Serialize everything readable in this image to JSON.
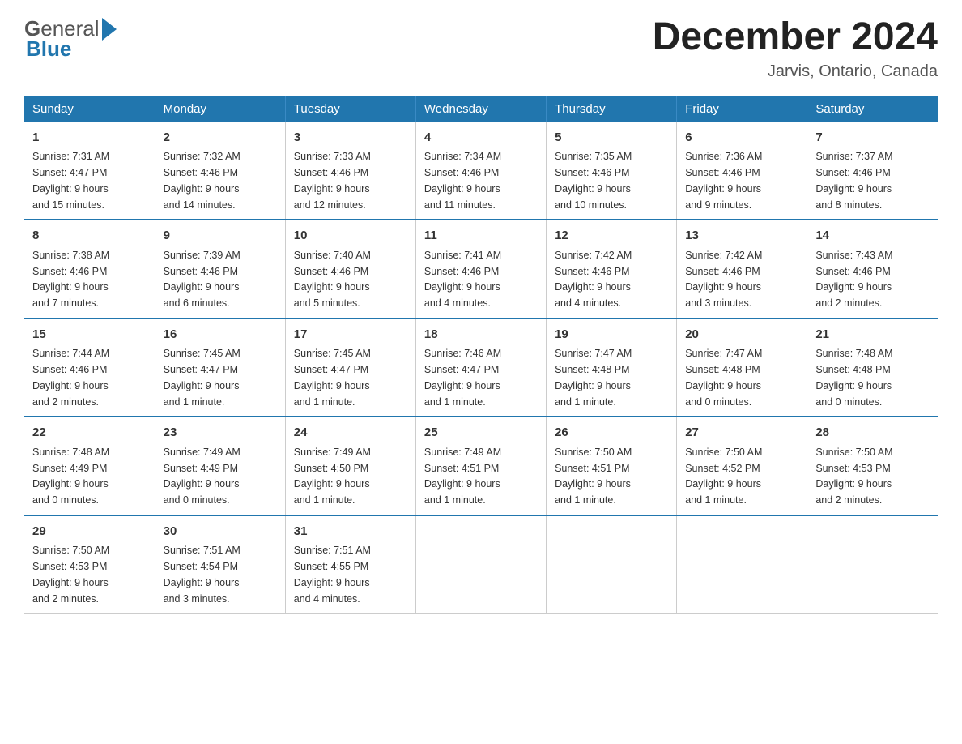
{
  "header": {
    "month_title": "December 2024",
    "location": "Jarvis, Ontario, Canada",
    "logo_general": "General",
    "logo_blue": "Blue"
  },
  "days_of_week": [
    "Sunday",
    "Monday",
    "Tuesday",
    "Wednesday",
    "Thursday",
    "Friday",
    "Saturday"
  ],
  "weeks": [
    [
      {
        "num": "1",
        "sunrise": "7:31 AM",
        "sunset": "4:47 PM",
        "daylight": "9 hours and 15 minutes."
      },
      {
        "num": "2",
        "sunrise": "7:32 AM",
        "sunset": "4:46 PM",
        "daylight": "9 hours and 14 minutes."
      },
      {
        "num": "3",
        "sunrise": "7:33 AM",
        "sunset": "4:46 PM",
        "daylight": "9 hours and 12 minutes."
      },
      {
        "num": "4",
        "sunrise": "7:34 AM",
        "sunset": "4:46 PM",
        "daylight": "9 hours and 11 minutes."
      },
      {
        "num": "5",
        "sunrise": "7:35 AM",
        "sunset": "4:46 PM",
        "daylight": "9 hours and 10 minutes."
      },
      {
        "num": "6",
        "sunrise": "7:36 AM",
        "sunset": "4:46 PM",
        "daylight": "9 hours and 9 minutes."
      },
      {
        "num": "7",
        "sunrise": "7:37 AM",
        "sunset": "4:46 PM",
        "daylight": "9 hours and 8 minutes."
      }
    ],
    [
      {
        "num": "8",
        "sunrise": "7:38 AM",
        "sunset": "4:46 PM",
        "daylight": "9 hours and 7 minutes."
      },
      {
        "num": "9",
        "sunrise": "7:39 AM",
        "sunset": "4:46 PM",
        "daylight": "9 hours and 6 minutes."
      },
      {
        "num": "10",
        "sunrise": "7:40 AM",
        "sunset": "4:46 PM",
        "daylight": "9 hours and 5 minutes."
      },
      {
        "num": "11",
        "sunrise": "7:41 AM",
        "sunset": "4:46 PM",
        "daylight": "9 hours and 4 minutes."
      },
      {
        "num": "12",
        "sunrise": "7:42 AM",
        "sunset": "4:46 PM",
        "daylight": "9 hours and 4 minutes."
      },
      {
        "num": "13",
        "sunrise": "7:42 AM",
        "sunset": "4:46 PM",
        "daylight": "9 hours and 3 minutes."
      },
      {
        "num": "14",
        "sunrise": "7:43 AM",
        "sunset": "4:46 PM",
        "daylight": "9 hours and 2 minutes."
      }
    ],
    [
      {
        "num": "15",
        "sunrise": "7:44 AM",
        "sunset": "4:46 PM",
        "daylight": "9 hours and 2 minutes."
      },
      {
        "num": "16",
        "sunrise": "7:45 AM",
        "sunset": "4:47 PM",
        "daylight": "9 hours and 1 minute."
      },
      {
        "num": "17",
        "sunrise": "7:45 AM",
        "sunset": "4:47 PM",
        "daylight": "9 hours and 1 minute."
      },
      {
        "num": "18",
        "sunrise": "7:46 AM",
        "sunset": "4:47 PM",
        "daylight": "9 hours and 1 minute."
      },
      {
        "num": "19",
        "sunrise": "7:47 AM",
        "sunset": "4:48 PM",
        "daylight": "9 hours and 1 minute."
      },
      {
        "num": "20",
        "sunrise": "7:47 AM",
        "sunset": "4:48 PM",
        "daylight": "9 hours and 0 minutes."
      },
      {
        "num": "21",
        "sunrise": "7:48 AM",
        "sunset": "4:48 PM",
        "daylight": "9 hours and 0 minutes."
      }
    ],
    [
      {
        "num": "22",
        "sunrise": "7:48 AM",
        "sunset": "4:49 PM",
        "daylight": "9 hours and 0 minutes."
      },
      {
        "num": "23",
        "sunrise": "7:49 AM",
        "sunset": "4:49 PM",
        "daylight": "9 hours and 0 minutes."
      },
      {
        "num": "24",
        "sunrise": "7:49 AM",
        "sunset": "4:50 PM",
        "daylight": "9 hours and 1 minute."
      },
      {
        "num": "25",
        "sunrise": "7:49 AM",
        "sunset": "4:51 PM",
        "daylight": "9 hours and 1 minute."
      },
      {
        "num": "26",
        "sunrise": "7:50 AM",
        "sunset": "4:51 PM",
        "daylight": "9 hours and 1 minute."
      },
      {
        "num": "27",
        "sunrise": "7:50 AM",
        "sunset": "4:52 PM",
        "daylight": "9 hours and 1 minute."
      },
      {
        "num": "28",
        "sunrise": "7:50 AM",
        "sunset": "4:53 PM",
        "daylight": "9 hours and 2 minutes."
      }
    ],
    [
      {
        "num": "29",
        "sunrise": "7:50 AM",
        "sunset": "4:53 PM",
        "daylight": "9 hours and 2 minutes."
      },
      {
        "num": "30",
        "sunrise": "7:51 AM",
        "sunset": "4:54 PM",
        "daylight": "9 hours and 3 minutes."
      },
      {
        "num": "31",
        "sunrise": "7:51 AM",
        "sunset": "4:55 PM",
        "daylight": "9 hours and 4 minutes."
      },
      null,
      null,
      null,
      null
    ]
  ],
  "labels": {
    "sunrise": "Sunrise:",
    "sunset": "Sunset:",
    "daylight": "Daylight:"
  }
}
